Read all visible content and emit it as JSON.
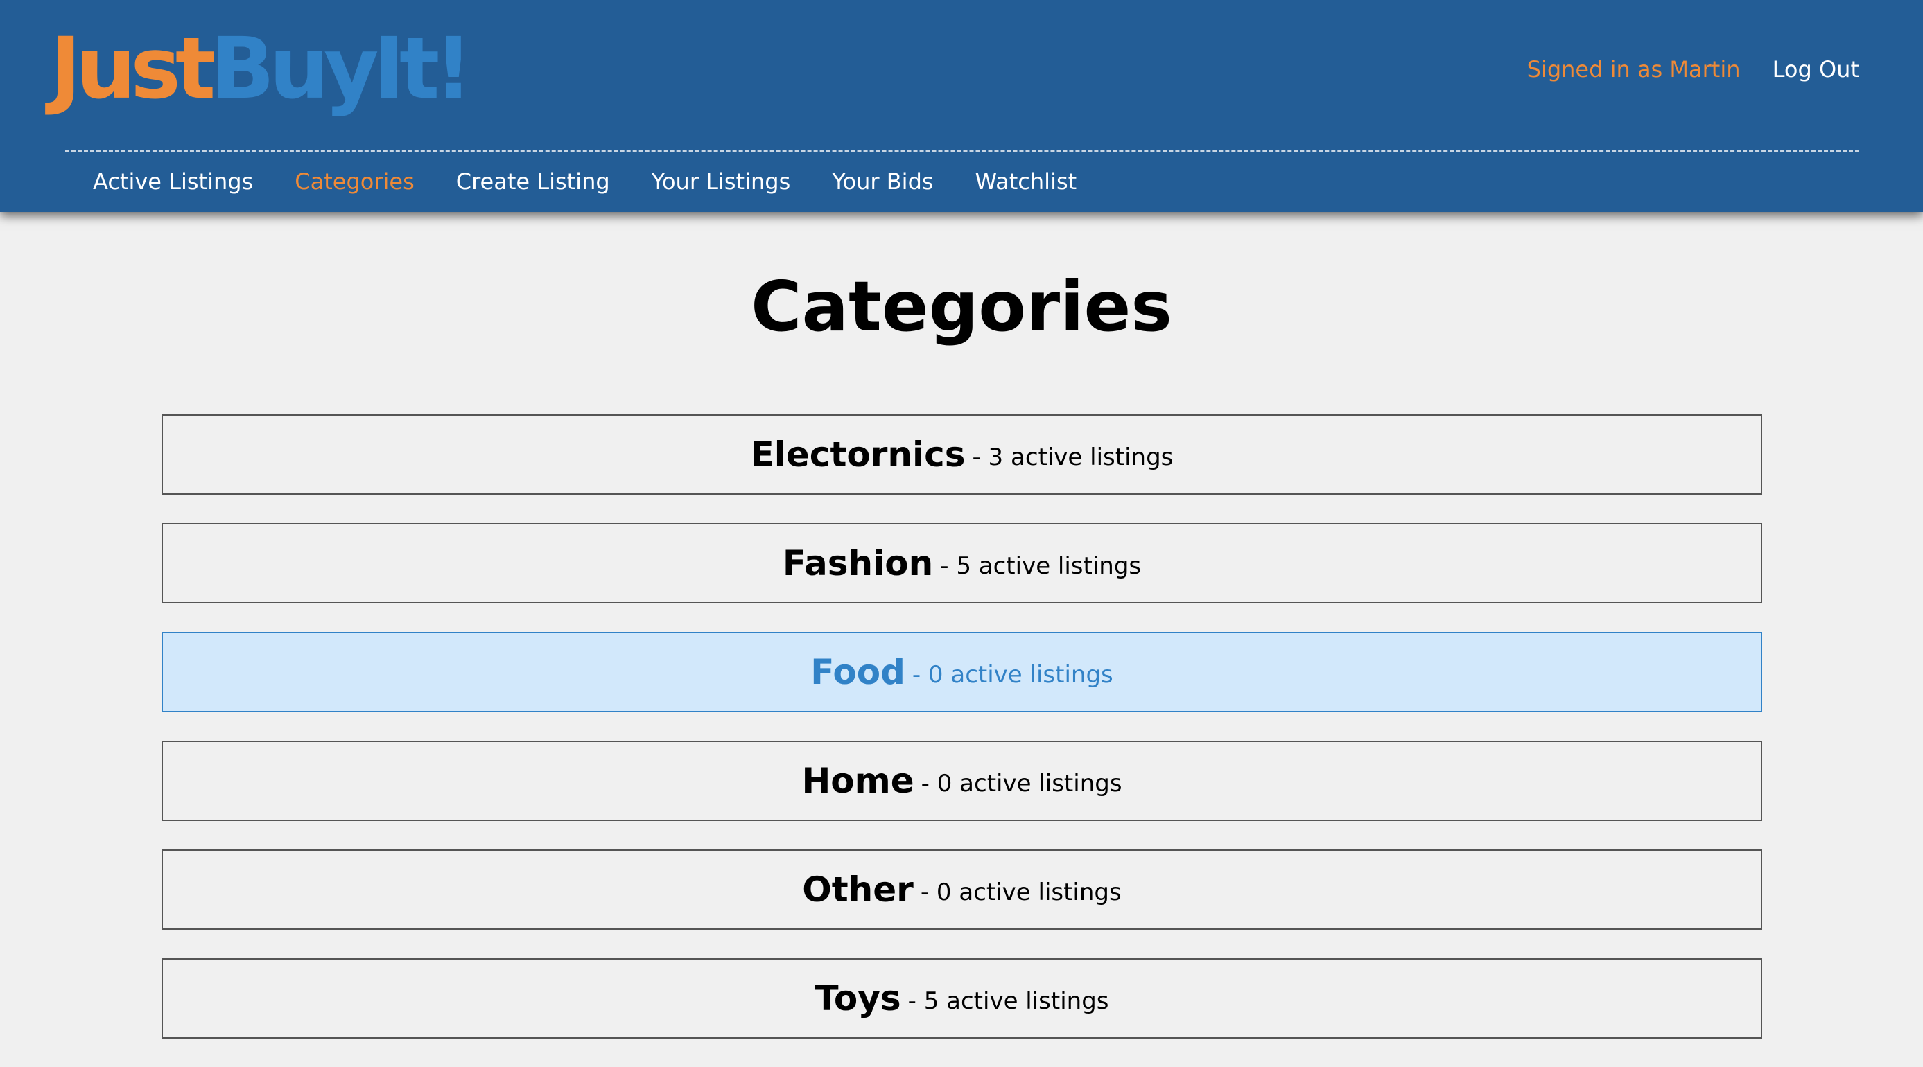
{
  "header": {
    "logo_part1": "Just",
    "logo_part2": "BuyIt!",
    "signed_in_text": "Signed in as Martin",
    "logout_label": "Log Out"
  },
  "nav": {
    "items": [
      {
        "label": "Active Listings",
        "active": false
      },
      {
        "label": "Categories",
        "active": true
      },
      {
        "label": "Create Listing",
        "active": false
      },
      {
        "label": "Your Listings",
        "active": false
      },
      {
        "label": "Your Bids",
        "active": false
      },
      {
        "label": "Watchlist",
        "active": false
      }
    ]
  },
  "page": {
    "title": "Categories"
  },
  "categories": [
    {
      "name": "Electornics",
      "count_text": "- 3 active listings",
      "highlighted": false
    },
    {
      "name": "Fashion",
      "count_text": "- 5 active listings",
      "highlighted": false
    },
    {
      "name": "Food",
      "count_text": "- 0 active listings",
      "highlighted": true
    },
    {
      "name": "Home",
      "count_text": "- 0 active listings",
      "highlighted": false
    },
    {
      "name": "Other",
      "count_text": "- 0 active listings",
      "highlighted": false
    },
    {
      "name": "Toys",
      "count_text": "- 5 active listings",
      "highlighted": false
    }
  ],
  "colors": {
    "header_bg": "#235d96",
    "accent_orange": "#ef8a37",
    "accent_blue": "#3182c7",
    "highlight_bg": "#d2e8fb",
    "page_bg": "#f0f0f0"
  }
}
